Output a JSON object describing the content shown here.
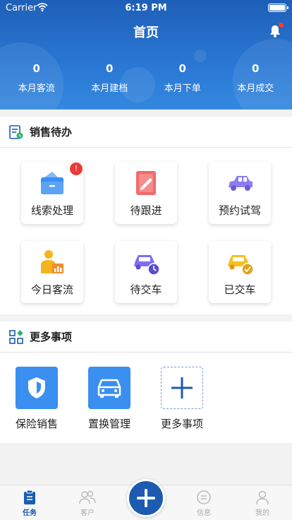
{
  "status_bar": {
    "carrier": "Carrier",
    "time": "6:19 PM"
  },
  "header": {
    "title": "首页",
    "stats": [
      {
        "value": "0",
        "label": "本月客流"
      },
      {
        "value": "0",
        "label": "本月建档"
      },
      {
        "value": "0",
        "label": "本月下单"
      },
      {
        "value": "0",
        "label": "本月成交"
      }
    ]
  },
  "todo": {
    "title": "销售待办",
    "items": [
      {
        "label": "线索处理",
        "icon": "lead-folder-icon",
        "badge": "!"
      },
      {
        "label": "待跟进",
        "icon": "follow-up-note-icon"
      },
      {
        "label": "预约试驾",
        "icon": "test-drive-car-icon"
      },
      {
        "label": "今日客流",
        "icon": "customer-flow-icon"
      },
      {
        "label": "待交车",
        "icon": "pending-delivery-car-icon"
      },
      {
        "label": "已交车",
        "icon": "delivered-car-icon"
      }
    ]
  },
  "more": {
    "title": "更多事项",
    "items": [
      {
        "label": "保险销售",
        "icon": "shield-icon"
      },
      {
        "label": "置换管理",
        "icon": "car-front-icon"
      },
      {
        "label": "更多事项",
        "icon": "plus-icon"
      }
    ]
  },
  "tabbar": {
    "items": [
      {
        "label": "任务",
        "icon": "clipboard-icon"
      },
      {
        "label": "客户",
        "icon": "people-icon"
      },
      {
        "label": "信息",
        "icon": "chat-icon"
      },
      {
        "label": "我的",
        "icon": "person-icon"
      }
    ],
    "active": "任务"
  },
  "colors": {
    "brand": "#1c5bb1",
    "header": "#2a78d4",
    "badge": "#ea3a3a"
  }
}
